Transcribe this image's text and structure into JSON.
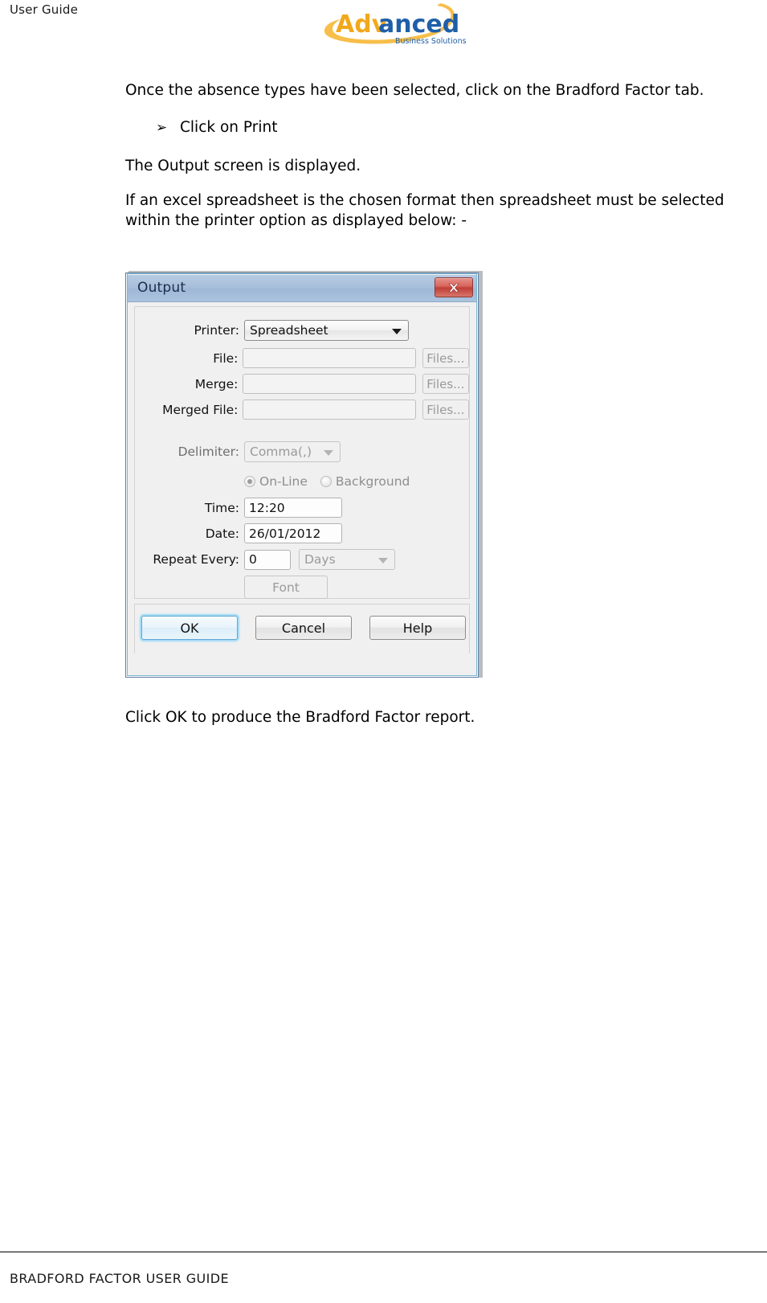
{
  "header": {
    "left_label": "User Guide",
    "logo": {
      "word_part1": "Adv",
      "word_part2": "anced",
      "tagline": "Business Solutions",
      "color_part1": "#f2a81d",
      "color_part2": "#1f5fa8",
      "color_tagline": "#1f5fa8",
      "color_swoosh": "#f6b93b"
    }
  },
  "content": {
    "paragraph_1": "Once the absence types have been selected, click on the Bradford Factor tab.",
    "bullet": {
      "glyph": "➢",
      "text": "Click on Print"
    },
    "paragraph_2": "The Output screen is displayed.",
    "paragraph_3": "If an excel spreadsheet is the chosen format then spreadsheet must be selected within the printer option as displayed below: -",
    "paragraph_4": "Click OK to produce the Bradford Factor report."
  },
  "dialog": {
    "title": "Output",
    "close_icon": "close-icon",
    "fields": {
      "printer": {
        "label": "Printer:",
        "value": "Spreadsheet",
        "enabled": true
      },
      "file": {
        "label": "File:",
        "value": "",
        "button": "Files..."
      },
      "merge": {
        "label": "Merge:",
        "value": "",
        "button": "Files..."
      },
      "merged_file": {
        "label": "Merged File:",
        "value": "",
        "button": "Files..."
      },
      "delimiter": {
        "label": "Delimiter:",
        "value": "Comma(,)",
        "enabled": false
      },
      "time": {
        "label": "Time:",
        "value": "12:20"
      },
      "date": {
        "label": "Date:",
        "value": "26/01/2012"
      },
      "repeat_every": {
        "label": "Repeat Every:",
        "value": "0",
        "unit": "Days"
      }
    },
    "mode_radios": [
      {
        "label": "On-Line",
        "selected": true
      },
      {
        "label": "Background",
        "selected": false
      }
    ],
    "font_button": "Font",
    "buttons": [
      {
        "label": "OK",
        "default": true
      },
      {
        "label": "Cancel",
        "default": false
      },
      {
        "label": "Help",
        "default": false
      }
    ],
    "colors": {
      "titlebar": "#a7bedb",
      "title_text": "#1b2c4a",
      "close_button": "#bf3f37",
      "dialog_face": "#f0f0f0",
      "default_button_glow": "#a8dcf5"
    }
  },
  "footer": {
    "text": "BRADFORD FACTOR USER GUIDE"
  }
}
